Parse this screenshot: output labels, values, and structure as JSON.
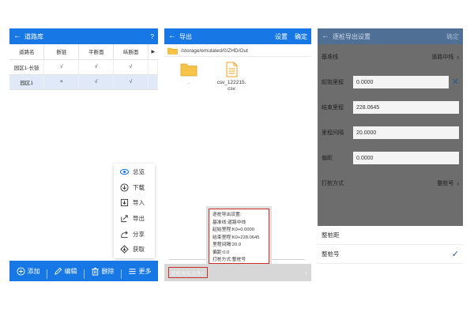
{
  "screen1": {
    "title": "道路库",
    "help": "?",
    "columns": [
      "道路名",
      "断链",
      "平断面",
      "纵断面"
    ],
    "rows": [
      [
        "园区1-长链",
        "√",
        "√",
        "√"
      ],
      [
        "园区1",
        "×",
        "√",
        "√"
      ]
    ],
    "menu": [
      {
        "label": "总览",
        "icon": "eye-icon"
      },
      {
        "label": "下载",
        "icon": "download-icon"
      },
      {
        "label": "导入",
        "icon": "import-icon"
      },
      {
        "label": "导出",
        "icon": "export-icon"
      },
      {
        "label": "分享",
        "icon": "share-icon"
      },
      {
        "label": "获取",
        "icon": "fetch-icon"
      }
    ],
    "bottom": [
      {
        "label": "添加",
        "icon": "add-icon"
      },
      {
        "label": "编辑",
        "icon": "edit-icon"
      },
      {
        "label": "删除",
        "icon": "delete-icon"
      },
      {
        "label": "更多",
        "icon": "more-icon"
      }
    ],
    "accent": "#1677e5"
  },
  "screen2": {
    "title": "导出",
    "settings": "设置",
    "confirm": "确定",
    "path": "/storage/emulated/0/ZHD/Out",
    "files": [
      {
        "name": "..",
        "type": "folder"
      },
      {
        "name": "csv_122215.\ncsv",
        "type": "file"
      }
    ],
    "info": [
      "逐桩导出设置:",
      "基准线:道路中线",
      "起始里程:K0+0.0000",
      "结束里程:K0+228.0645",
      "里程间隔:20.0",
      "偏距:0.0",
      "打桩方式:整桩号"
    ],
    "bottom_label": "逐桩坐标文件(*",
    "highlight": "#c9302c"
  },
  "screen3": {
    "title": "逐桩导出设置",
    "confirm": "确定",
    "rows": [
      {
        "label": "基准线",
        "value": "道路中线",
        "kind": "select"
      },
      {
        "label": "起始里程",
        "value": "0.0000",
        "kind": "input-clear"
      },
      {
        "label": "结束里程",
        "value": "228.0645",
        "kind": "input"
      },
      {
        "label": "里程间隔",
        "value": "20.0000",
        "kind": "input"
      },
      {
        "label": "偏距",
        "value": "0.0000",
        "kind": "input"
      },
      {
        "label": "打桩方式",
        "value": "整桩号",
        "kind": "select"
      }
    ],
    "options": [
      {
        "label": "整桩距",
        "selected": false
      },
      {
        "label": "整桩号",
        "selected": true
      }
    ]
  }
}
